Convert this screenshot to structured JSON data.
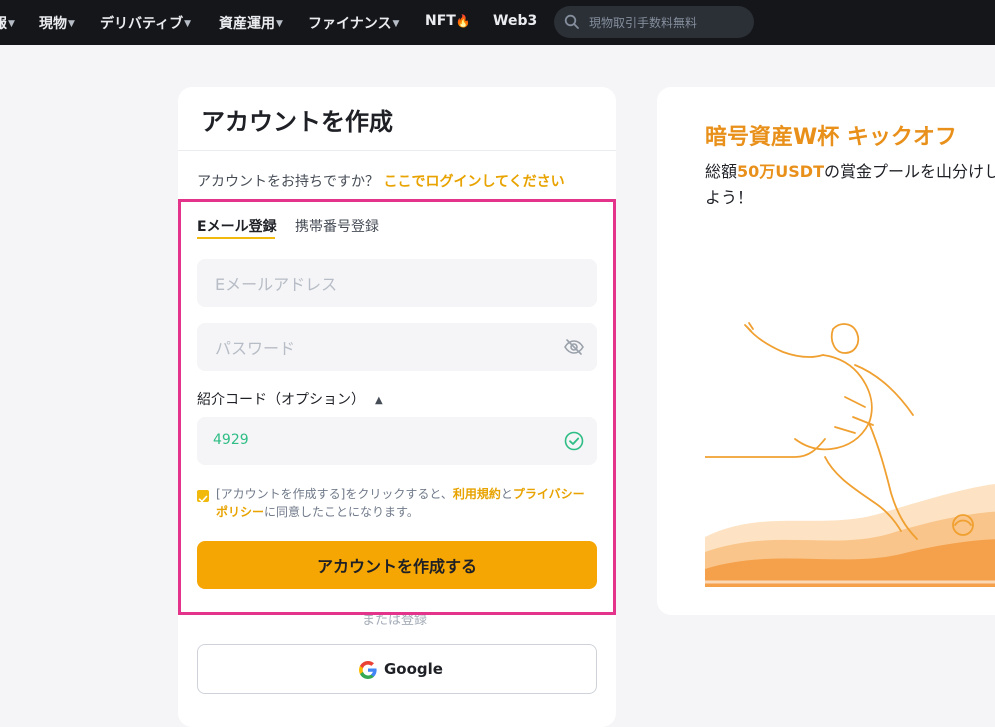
{
  "nav": {
    "items": [
      {
        "label": "報",
        "caret": true
      },
      {
        "label": "現物",
        "caret": true
      },
      {
        "label": "デリバティブ",
        "caret": true
      },
      {
        "label": "資産運用",
        "caret": true
      },
      {
        "label": "ファイナンス",
        "caret": true
      },
      {
        "label": "NFT",
        "caret": false
      },
      {
        "label": "Web3",
        "caret": false
      }
    ],
    "search_placeholder": "現物取引手数料無料"
  },
  "form": {
    "title": "アカウントを作成",
    "have_account_text": "アカウントをお持ちですか？",
    "login_link": "ここでログインしてください",
    "tabs": [
      "Eメール登録",
      "携帯番号登録"
    ],
    "active_tab": 0,
    "email_placeholder": "Eメールアドレス",
    "password_placeholder": "パスワード",
    "referral_label": "紹介コード（オプション）",
    "referral_value": "4929",
    "agree": {
      "prefix": "[アカウントを作成する]をクリックすると、",
      "terms": "利用規約",
      "and": "と",
      "privacy": "プライバシーポリシー",
      "suffix": "に同意したことになります。",
      "checked": true
    },
    "submit_label": "アカウントを作成する",
    "or_text": "または登録",
    "google_label": "Google"
  },
  "promo": {
    "title": "暗号資産W杯 キックオフ",
    "sub_prefix": "総額",
    "sub_highlight": "50万USDT",
    "sub_suffix": "の賞金プールを山分けしよう！"
  },
  "colors": {
    "accent": "#f6a602",
    "link": "#e8a300",
    "highlight_border": "#e4338a",
    "success": "#2ebd85",
    "nav_bg": "#15161a"
  }
}
